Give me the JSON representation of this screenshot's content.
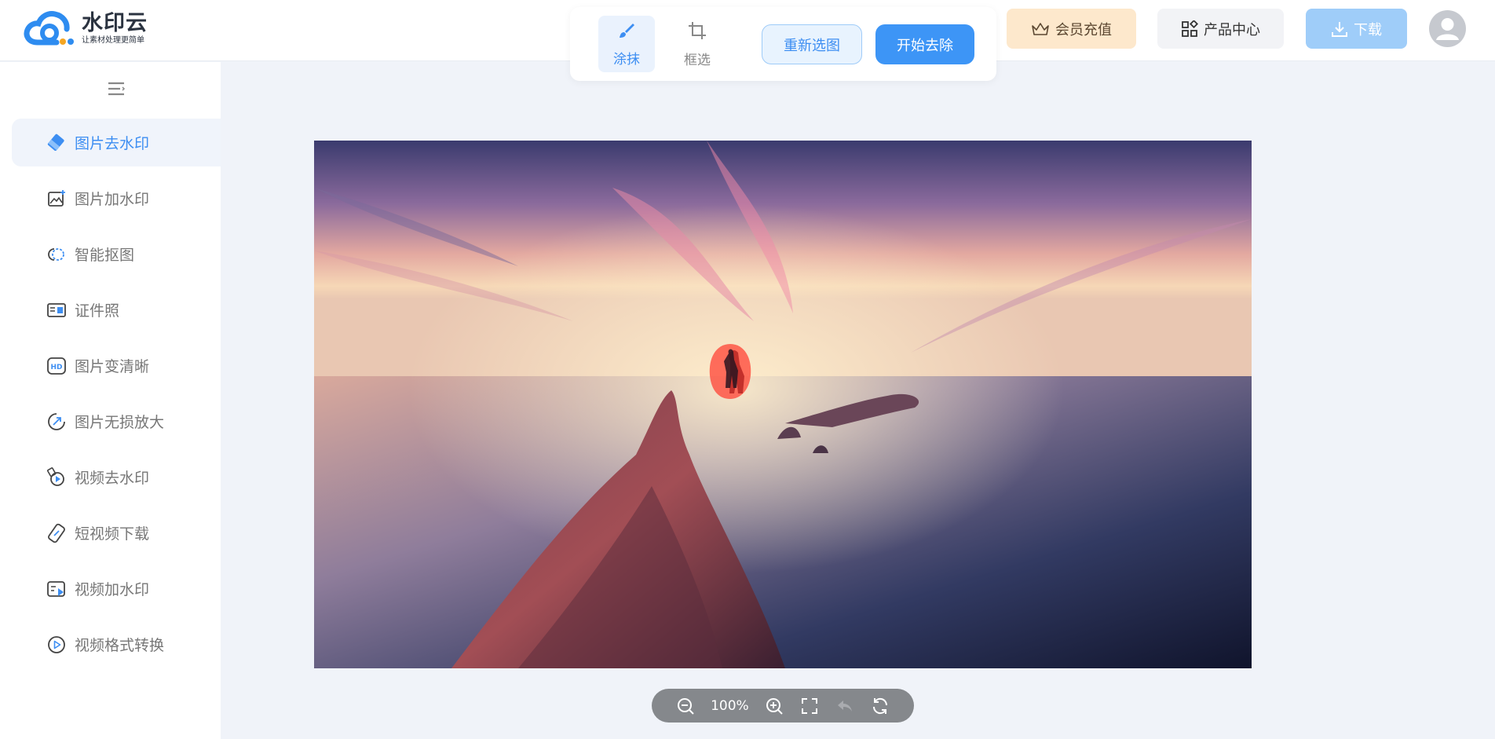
{
  "app": {
    "name": "水印云",
    "slogan": "让素材处理更简单"
  },
  "toolbar": {
    "tools": [
      {
        "label": "涂抹",
        "icon": "brush-icon",
        "active": true
      },
      {
        "label": "框选",
        "icon": "crop-icon",
        "active": false
      }
    ],
    "reselect_label": "重新选图",
    "start_label": "开始去除"
  },
  "header": {
    "vip_label": "会员充值",
    "products_label": "产品中心",
    "download_label": "下载"
  },
  "sidebar": {
    "items": [
      {
        "label": "图片去水印",
        "icon": "eraser-icon",
        "active": true
      },
      {
        "label": "图片加水印",
        "icon": "image-add-icon",
        "active": false
      },
      {
        "label": "智能抠图",
        "icon": "cutout-icon",
        "active": false
      },
      {
        "label": "证件照",
        "icon": "id-card-icon",
        "active": false
      },
      {
        "label": "图片变清晰",
        "icon": "hd-icon",
        "active": false
      },
      {
        "label": "图片无损放大",
        "icon": "enlarge-icon",
        "active": false
      },
      {
        "label": "视频去水印",
        "icon": "video-eraser-icon",
        "active": false
      },
      {
        "label": "短视频下载",
        "icon": "link-icon",
        "active": false
      },
      {
        "label": "视频加水印",
        "icon": "video-add-icon",
        "active": false
      },
      {
        "label": "视频格式转换",
        "icon": "play-circle-icon",
        "active": false
      }
    ]
  },
  "zoom": {
    "percent": "100%"
  },
  "colors": {
    "accent": "#3d95f6",
    "vip_bg": "#fde8cc",
    "mask": "#ff3b2f"
  }
}
